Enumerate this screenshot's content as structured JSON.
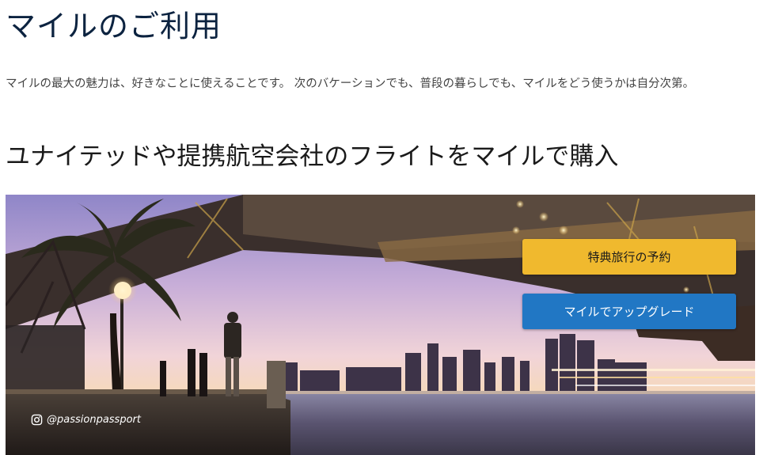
{
  "page": {
    "title": "マイルのご利用",
    "intro": "マイルの最大の魅力は、好きなことに使えることです。 次のバケーションでも、普段の暮らしでも、マイルをどう使うかは自分次第。",
    "section_title": "ユナイテッドや提携航空会社のフライトをマイルで購入"
  },
  "hero": {
    "image": "sydney-harbour-bridge-photo",
    "buttons": {
      "award_label": "特典旅行の予約",
      "upgrade_label": "マイルでアップグレード"
    },
    "credit": "@passionpassport",
    "credit_icon": "instagram-icon"
  },
  "colors": {
    "title": "#0c2340",
    "award_button": "#f0b92e",
    "upgrade_button": "#2177c4"
  }
}
